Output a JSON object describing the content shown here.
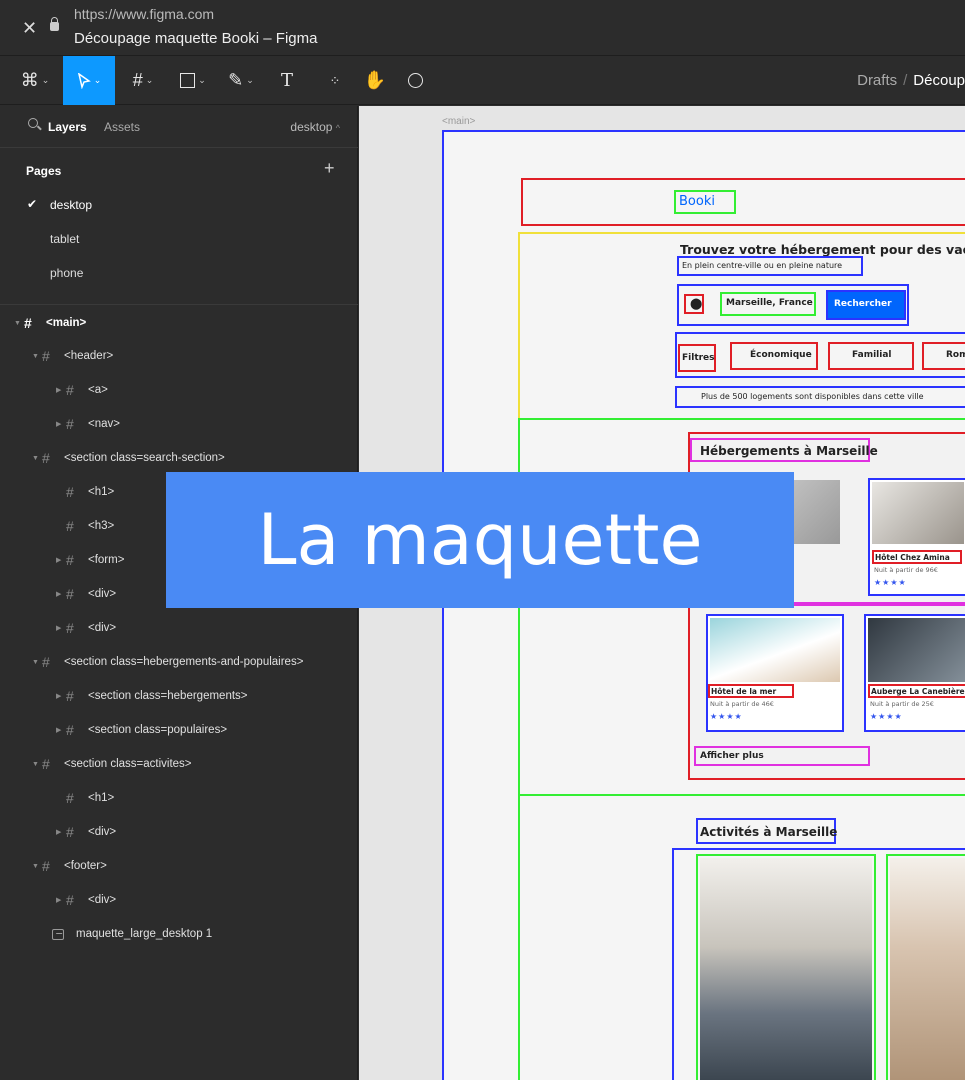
{
  "browser": {
    "url": "https://www.figma.com",
    "title": "Découpage maquette Booki – Figma",
    "close_icon": "close-icon",
    "lock_icon": "lock-icon"
  },
  "toolbar": {
    "tools": [
      "figma-menu-icon",
      "move-tool-icon",
      "frame-tool-icon",
      "shape-tool-icon",
      "pen-tool-icon",
      "text-tool-icon",
      "resources-icon",
      "hand-tool-icon",
      "comment-icon"
    ],
    "breadcrumb": {
      "root": "Drafts",
      "separator": "/",
      "current": "Découp"
    }
  },
  "sidebar": {
    "tab_layers": "Layers",
    "tab_assets": "Assets",
    "page_selector": "desktop",
    "pages_heading": "Pages",
    "pages": [
      "desktop",
      "tablet",
      "phone"
    ],
    "current_page": "desktop",
    "layers": [
      {
        "label": "<main>"
      },
      {
        "label": "<header>"
      },
      {
        "label": "<a>"
      },
      {
        "label": "<nav>"
      },
      {
        "label": "<section class=search-section>"
      },
      {
        "label": "<h1>"
      },
      {
        "label": "<h3>"
      },
      {
        "label": "<form>"
      },
      {
        "label": "<div>"
      },
      {
        "label": "<div>"
      },
      {
        "label": "<section class=hebergements-and-populaires>"
      },
      {
        "label": "<section class=hebergements>"
      },
      {
        "label": "<section class=populaires>"
      },
      {
        "label": "<section class=activites>"
      },
      {
        "label": "<h1>"
      },
      {
        "label": "<div>"
      },
      {
        "label": "<footer>"
      },
      {
        "label": "<div>"
      },
      {
        "label": "maquette_large_desktop 1"
      }
    ]
  },
  "canvas": {
    "frame_label": "<main>",
    "logo": "Booki",
    "search_title": "Trouvez votre hébergement pour des vacances",
    "search_subtitle": "En plein centre-ville ou en pleine nature",
    "search_location": "Marseille, France",
    "search_button": "Rechercher",
    "filters_label": "Filtres",
    "filters": [
      "Économique",
      "Familial",
      "Rom"
    ],
    "info_text": "Plus de 500 logements sont disponibles dans cette ville",
    "hebergements_title": "Hébergements à Marseille",
    "cards": [
      {
        "name": "Hôtel Chez Amina",
        "price": "Nuit à partir de 96€"
      },
      {
        "name": "Hôtel de la mer",
        "price": "Nuit à partir de 46€"
      },
      {
        "name": "Auberge La Canebière",
        "price": "Nuit à partir de 25€"
      }
    ],
    "show_more": "Afficher plus",
    "activites_title": "Activités à Marseille"
  },
  "overlay": {
    "text": "La maquette"
  }
}
